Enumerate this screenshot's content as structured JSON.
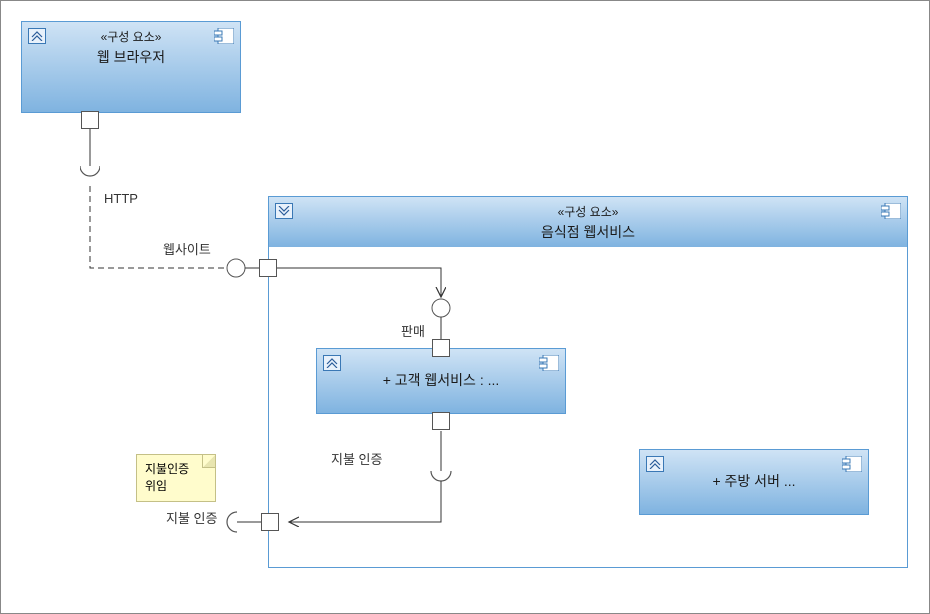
{
  "components": {
    "browser": {
      "stereotype": "«구성 요소»",
      "name": "웹 브라우저"
    },
    "restaurant": {
      "stereotype": "«구성 요소»",
      "name": "음식점 웹서비스"
    },
    "customer": {
      "name": "+ 고객 웹서비스 : ..."
    },
    "kitchen": {
      "name": "+ 주방 서버 ..."
    }
  },
  "labels": {
    "http": "HTTP",
    "website": "웹사이트",
    "sales": "판매",
    "paymentAuth1": "지불 인증",
    "paymentAuth2": "지불 인증"
  },
  "note": {
    "line1": "지불인증",
    "line2": "위임"
  }
}
